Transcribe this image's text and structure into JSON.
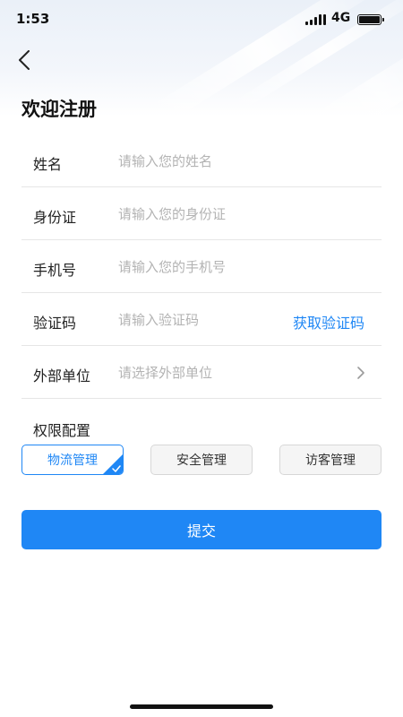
{
  "status_bar": {
    "time": "1:53",
    "network": "4G"
  },
  "header": {
    "back_icon": "chevron-left-icon",
    "title": "欢迎注册"
  },
  "form": {
    "name": {
      "label": "姓名",
      "placeholder": "请输入您的姓名"
    },
    "id_card": {
      "label": "身份证",
      "placeholder": "请输入您的身份证"
    },
    "phone": {
      "label": "手机号",
      "placeholder": "请输入您的手机号"
    },
    "code": {
      "label": "验证码",
      "placeholder": "请输入验证码",
      "action_label": "获取验证码"
    },
    "unit": {
      "label": "外部单位",
      "placeholder": "请选择外部单位",
      "chevron_icon": "chevron-right-icon"
    }
  },
  "permissions": {
    "title": "权限配置",
    "options": [
      {
        "label": "物流管理",
        "selected": true
      },
      {
        "label": "安全管理",
        "selected": false
      },
      {
        "label": "访客管理",
        "selected": false
      }
    ]
  },
  "submit": {
    "label": "提交"
  },
  "colors": {
    "accent": "#1f87f5",
    "placeholder": "#b3b3b3",
    "divider": "#e6e6e6"
  }
}
